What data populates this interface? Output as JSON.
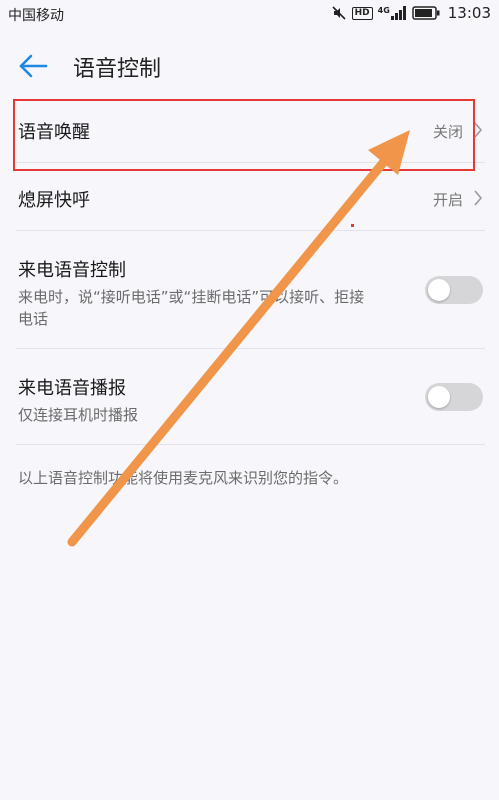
{
  "status_bar": {
    "carrier": "中国移动",
    "network_badge": "HD",
    "network_type": "4G",
    "time": "13:03",
    "icons": [
      "mute-icon",
      "signal-icon",
      "battery-icon"
    ]
  },
  "header": {
    "title": "语音控制",
    "back_icon": "back-arrow-icon"
  },
  "settings": {
    "voice_wakeup": {
      "label": "语音唤醒",
      "value": "关闭"
    },
    "screen_off_call": {
      "label": "熄屏快呼",
      "value": "开启"
    },
    "incoming_call_voice_control": {
      "label": "来电语音控制",
      "description": "来电时，说“接听电话”或“挂断电话”可以接听、拒接电话",
      "enabled": false
    },
    "incoming_call_announcement": {
      "label": "来电语音播报",
      "description": "仅连接耳机时播报",
      "enabled": false
    }
  },
  "footer_note": "以上语音控制功能将使用麦克风来识别您的指令。",
  "colors": {
    "background": "#f7f6fb",
    "accent": "#1e88e5",
    "highlight_box": "#e53935",
    "annotation_arrow": "#f0954a"
  }
}
